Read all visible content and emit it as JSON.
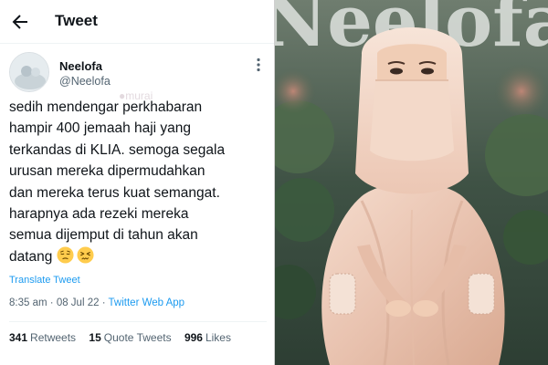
{
  "header": {
    "title": "Tweet",
    "back_icon": "back-arrow-icon"
  },
  "tweet": {
    "author_name": "Neelofa",
    "author_handle": "@Neelofa",
    "lines": [
      "sedih mendengar perkhabaran",
      "hampir 400 jemaah haji yang",
      "terkandas di KLIA. semoga segala",
      "urusan mereka dipermudahkan",
      "dan mereka terus kuat semangat.",
      "harapnya ada rezeki mereka",
      "semua dijemput di tahun akan",
      "datang"
    ],
    "emojis": [
      "pensive-face-emoji",
      "persevering-face-emoji"
    ],
    "translate_label": "Translate Tweet",
    "time": "8:35 am",
    "separator": "·",
    "date": "08 Jul 22",
    "source": "Twitter Web App"
  },
  "stats": {
    "retweets_count": "341",
    "retweets_label": "Retweets",
    "quotes_count": "15",
    "quotes_label": "Quote Tweets",
    "likes_count": "996",
    "likes_label": "Likes"
  },
  "watermark": {
    "text": "murai"
  },
  "photo": {
    "backdrop_text": "Neelofa"
  },
  "colors": {
    "link": "#1d9bf0",
    "muted": "#536471",
    "text": "#0f1419",
    "emoji_yellow": "#ffcc4d"
  }
}
